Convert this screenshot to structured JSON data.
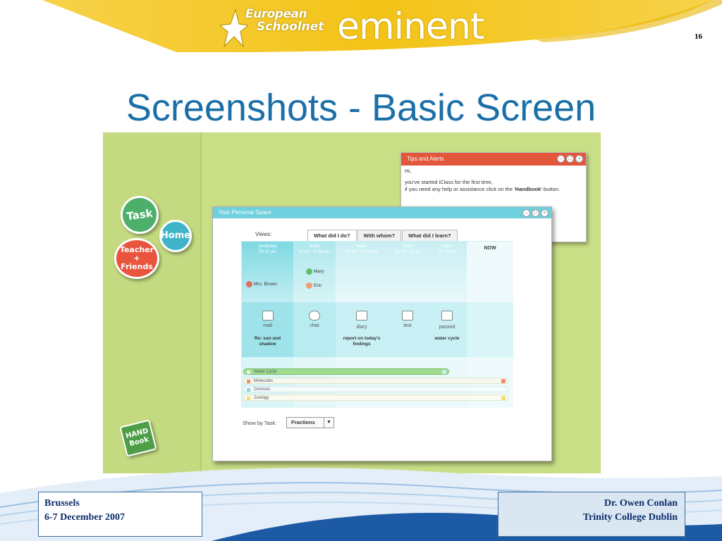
{
  "header": {
    "logo_line1": "European",
    "logo_line2": "Schoolnet",
    "brand": "eminent",
    "page_number": "16",
    "brand_color": "#f5c518"
  },
  "slide": {
    "title": "Screenshots - Basic Screen",
    "title_color": "#1b6fa8"
  },
  "app": {
    "sidebar": {
      "task": "Task",
      "home": "Home",
      "teacher_line1": "Teacher",
      "teacher_line2": "+ Friends",
      "handbook_line1": "HAND",
      "handbook_line2": "Book"
    },
    "tips": {
      "title": "Tips and Alerts",
      "greeting": "Hi,",
      "line1": "you've started iClass for the first time,",
      "line2_pre": "if you need any help or assistance click on the '",
      "line2_bold": "Handbook",
      "line2_post": "'-button."
    },
    "personal_space": {
      "title": "Your Personal Space",
      "views_label": "Views:",
      "tabs": [
        "What did I do?",
        "With whom?",
        "What did I learn?"
      ],
      "columns": [
        {
          "day": "yesterday",
          "time": "03:25 pm"
        },
        {
          "day": "today",
          "time": "11:15 - 11:54 am"
        },
        {
          "day": "today",
          "time": "01:00 - 02:00 pm"
        },
        {
          "day": "today",
          "time": "02:02 - 02:24"
        },
        {
          "day": "today",
          "time": "02:25 pm"
        },
        {
          "day": "NOW",
          "time": ""
        }
      ],
      "people": [
        "Mrs. Brown",
        "Mary",
        "Eric"
      ],
      "activities": [
        {
          "icon": "mail",
          "label": "mail",
          "detail_1": "Re: sun and",
          "detail_2": "shadow"
        },
        {
          "icon": "chat",
          "label": "chat",
          "detail_1": "",
          "detail_2": ""
        },
        {
          "icon": "diary",
          "label": "diary",
          "detail_1": "report on today's",
          "detail_2": "findings"
        },
        {
          "icon": "test",
          "label": "test",
          "detail_1": "",
          "detail_2": ""
        },
        {
          "icon": "passed",
          "label": "passed",
          "detail_1": "water cycle",
          "detail_2": ""
        }
      ],
      "tasks": [
        {
          "name": "Water Cycle",
          "color": "#7ccf6e"
        },
        {
          "name": "Molecules",
          "color": "#f08a6a"
        },
        {
          "name": "Osmosis",
          "color": "#8fd6e2"
        },
        {
          "name": "Zoology",
          "color": "#f0e070"
        }
      ],
      "show_by_label": "Show by Task:",
      "show_by_value": "Fractions"
    }
  },
  "footer": {
    "left_line1": "Brussels",
    "left_line2": "6-7 December 2007",
    "right_line1": "Dr. Owen Conlan",
    "right_line2": "Trinity College Dublin"
  }
}
